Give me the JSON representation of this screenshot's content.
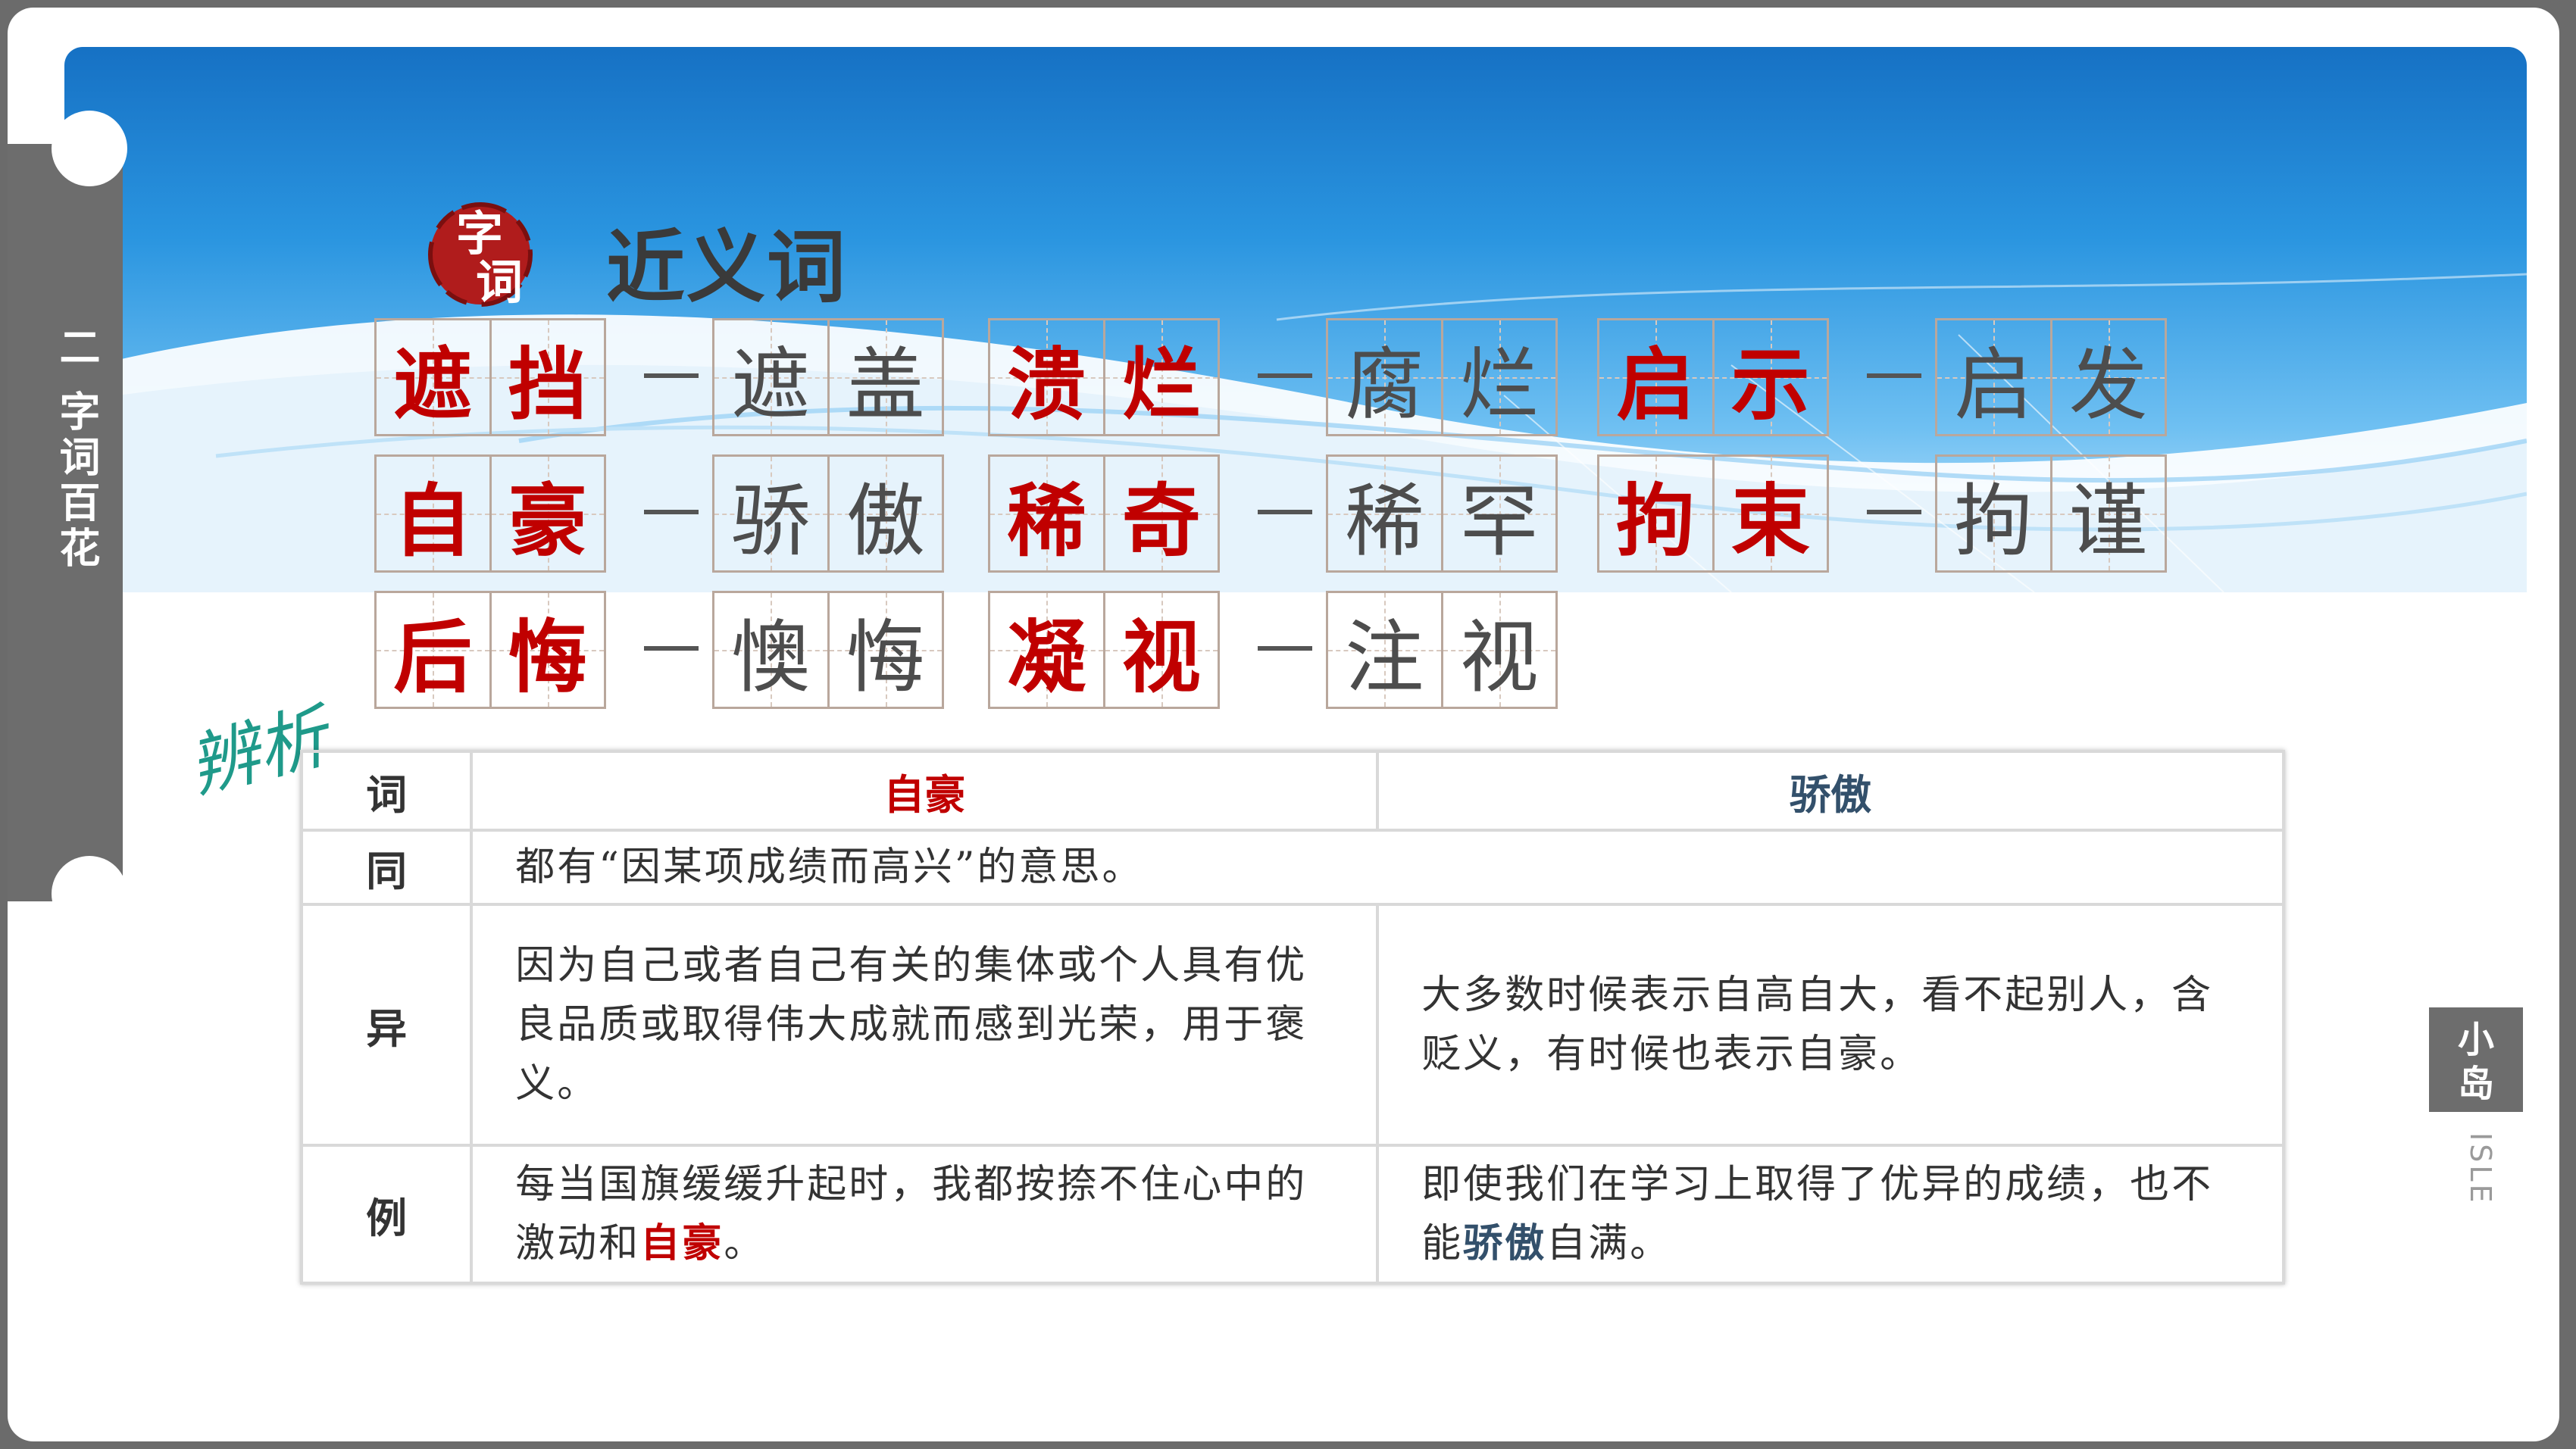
{
  "side_tab": {
    "label": "二 字词百花"
  },
  "header": {
    "logo_chars": [
      "字",
      "词"
    ],
    "title": "近义词"
  },
  "pairs": [
    {
      "a": [
        "遮",
        "挡"
      ],
      "b": [
        "遮",
        "盖"
      ]
    },
    {
      "a": [
        "溃",
        "烂"
      ],
      "b": [
        "腐",
        "烂"
      ]
    },
    {
      "a": [
        "启",
        "示"
      ],
      "b": [
        "启",
        "发"
      ]
    },
    {
      "a": [
        "自",
        "豪"
      ],
      "b": [
        "骄",
        "傲"
      ]
    },
    {
      "a": [
        "稀",
        "奇"
      ],
      "b": [
        "稀",
        "罕"
      ]
    },
    {
      "a": [
        "拘",
        "束"
      ],
      "b": [
        "拘",
        "谨"
      ]
    },
    {
      "a": [
        "后",
        "悔"
      ],
      "b": [
        "懊",
        "悔"
      ]
    },
    {
      "a": [
        "凝",
        "视"
      ],
      "b": [
        "注",
        "视"
      ]
    }
  ],
  "bianxi_label": "辨析",
  "table": {
    "header": [
      "词",
      "自豪",
      "骄傲"
    ],
    "rows": [
      {
        "label": "同",
        "common": "都有“因某项成绩而高兴”的意思。"
      },
      {
        "label": "异",
        "a": "因为自己或者自己有关的集体或个人具有优良品质或取得伟大成就而感到光荣，用于褒义。",
        "b": "大多数时候表示自高自大，看不起别人，含贬义，有时候也表示自豪。"
      },
      {
        "label": "例",
        "a_pre": "每当国旗缓缓升起时，我都按捺不住心中的激动和",
        "a_hl": "自豪",
        "a_post": "。",
        "b_pre": "即使我们在学习上取得了优异的成绩，也不能",
        "b_hl": "骄傲",
        "b_post": "自满。"
      }
    ]
  },
  "badge": {
    "line1": "小",
    "line2": "岛"
  },
  "isle": "ISLE",
  "colors": {
    "accent_red": "#c00000",
    "accent_blue": "#33506b",
    "banner_blue": "#1f86d6",
    "tab_gray": "#6d6d6d"
  }
}
